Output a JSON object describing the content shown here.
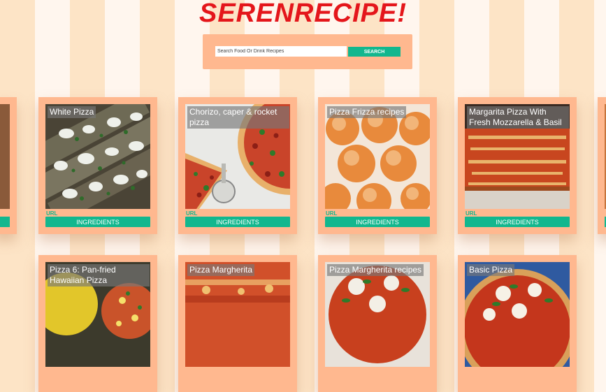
{
  "app": {
    "title": "SERENRECIPE!"
  },
  "search": {
    "placeholder": "Search Food Or Drink Recipes",
    "button_label": "SEARCH"
  },
  "cards": [
    {
      "title": "White Pizza",
      "url_label": "URL",
      "button_label": "INGREDIENTS"
    },
    {
      "title": "Chorizo, caper & rocket pizza",
      "url_label": "URL",
      "button_label": "INGREDIENTS"
    },
    {
      "title": "Pizza Frizza recipes",
      "url_label": "URL",
      "button_label": "INGREDIENTS"
    },
    {
      "title": "Margarita Pizza With Fresh Mozzarella & Basil",
      "url_label": "URL",
      "button_label": "INGREDIENTS"
    },
    {
      "title": "Pizza 6: Pan-fried Hawaiian Pizza"
    },
    {
      "title": "Pizza Margherita"
    },
    {
      "title": "Pizza Margherita recipes"
    },
    {
      "title": "Basic Pizza"
    }
  ],
  "colors": {
    "accent": "#12b78e",
    "brand": "#e4161b",
    "card": "#ffb88f"
  }
}
